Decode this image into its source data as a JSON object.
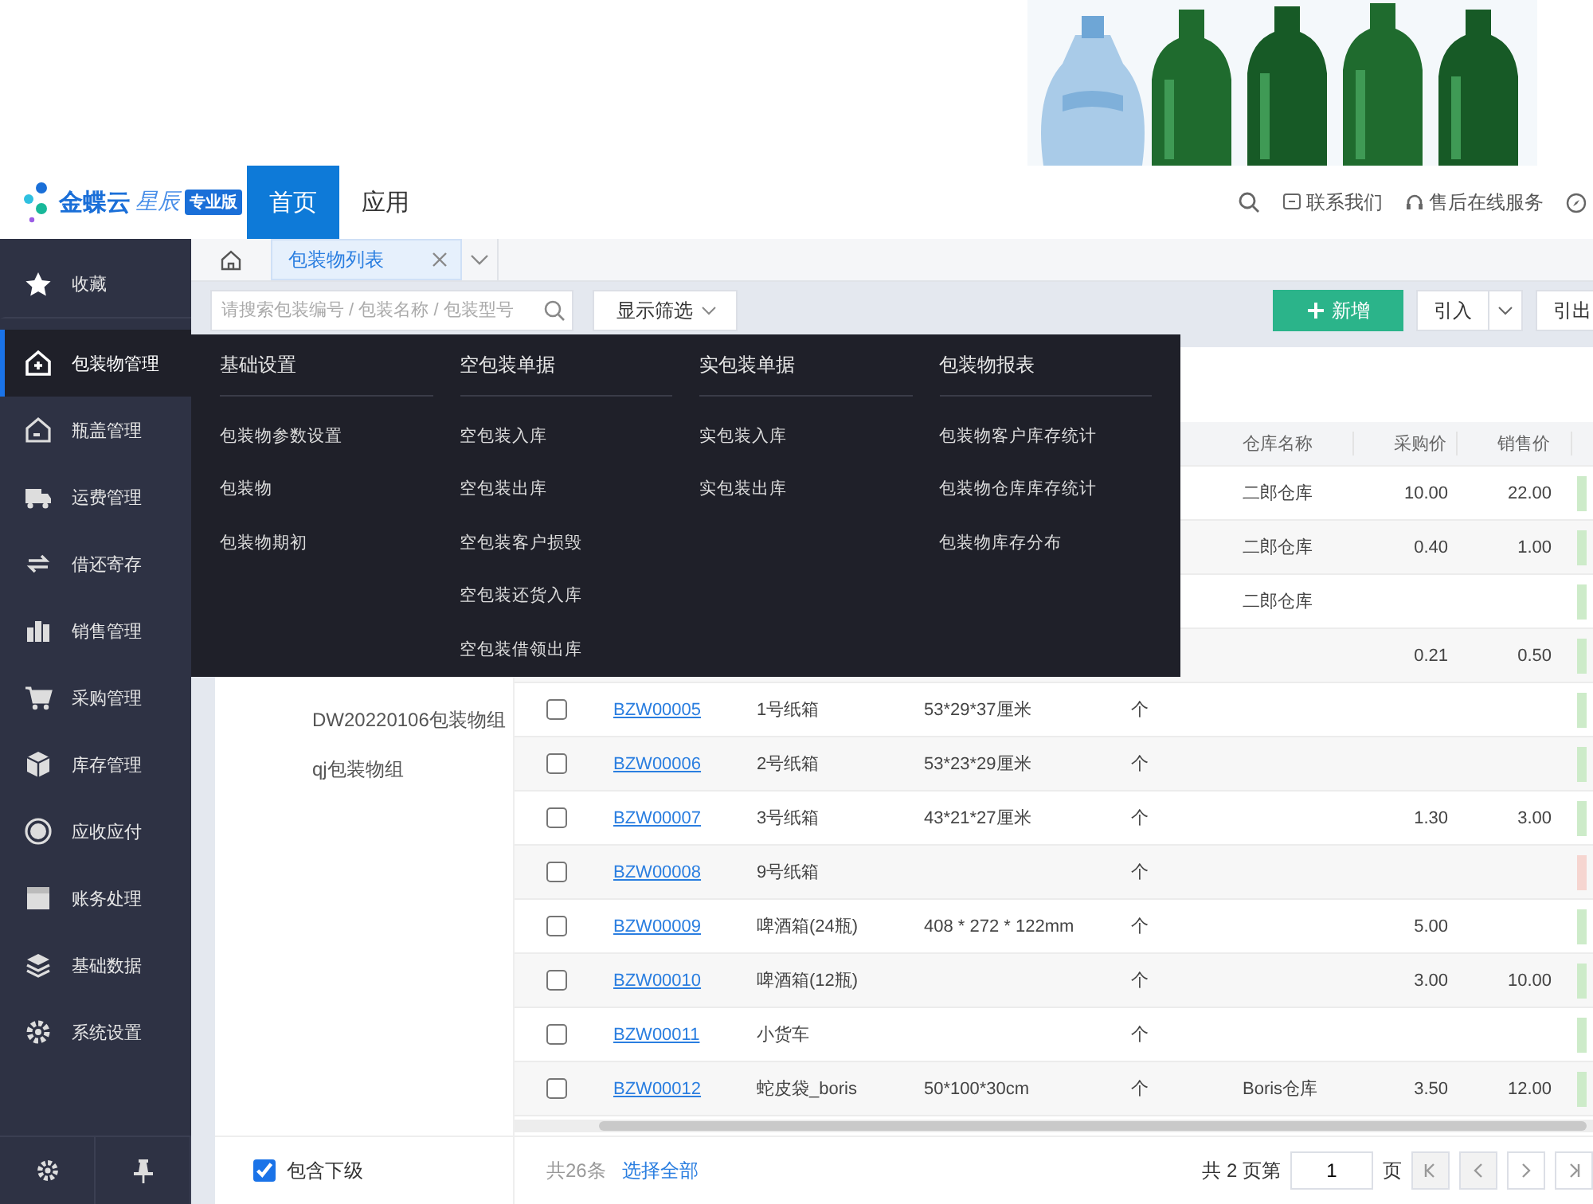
{
  "header": {
    "logo": {
      "name": "金蝶云",
      "sub": "星辰",
      "badge": "专业版"
    },
    "tabs": [
      {
        "label": "首页",
        "selected": true
      },
      {
        "label": "应用",
        "selected": false
      }
    ],
    "links": [
      "联系我们",
      "售后在线服务"
    ]
  },
  "sidebar": {
    "items": [
      {
        "label": "收藏",
        "selected": false
      },
      {
        "label": "包装物管理",
        "selected": true
      },
      {
        "label": "瓶盖管理",
        "selected": false
      },
      {
        "label": "运费管理",
        "selected": false
      },
      {
        "label": "借还寄存",
        "selected": false
      },
      {
        "label": "销售管理",
        "selected": false
      },
      {
        "label": "采购管理",
        "selected": false
      },
      {
        "label": "库存管理",
        "selected": false
      },
      {
        "label": "应收应付",
        "selected": false
      },
      {
        "label": "账务处理",
        "selected": false
      },
      {
        "label": "基础数据",
        "selected": false
      },
      {
        "label": "系统设置",
        "selected": false
      }
    ]
  },
  "tab_bar": {
    "tabs": [
      {
        "label": "包装物列表",
        "selected": true
      }
    ]
  },
  "toolbar": {
    "search": {
      "placeholder": "请搜索包装编号 / 包装名称 / 包装型号"
    },
    "filter_button": "显示筛选",
    "buttons": [
      {
        "label": "新增",
        "kind": "primary"
      },
      {
        "label": "引入",
        "kind": "split"
      },
      {
        "label": "引出",
        "kind": "plain"
      }
    ]
  },
  "menu": {
    "columns": [
      {
        "title": "基础设置",
        "items": [
          "包装物参数设置",
          "包装物",
          "包装物期初"
        ]
      },
      {
        "title": "空包装单据",
        "items": [
          "空包装入库",
          "空包装出库",
          "空包装客户损毁",
          "空包装还货入库",
          "空包装借领出库"
        ]
      },
      {
        "title": "实包装单据",
        "items": [
          "实包装入库",
          "实包装出库"
        ]
      },
      {
        "title": "包装物报表",
        "items": [
          "包装物客户库存统计",
          "包装物仓库库存统计",
          "包装物库存分布"
        ]
      }
    ]
  },
  "tree": {
    "items": [
      "DW20220106包装物组",
      "qj包装物组"
    ]
  },
  "table": {
    "columns": [
      "仓库名称",
      "采购价",
      "销售价"
    ],
    "rows": [
      {
        "warehouse": "二郎仓库",
        "purchase_price": "10.00",
        "sale_price": "22.00",
        "color": "#cdebc9"
      },
      {
        "warehouse": "二郎仓库",
        "purchase_price": "0.40",
        "sale_price": "1.00",
        "color": "#cdebc9"
      },
      {
        "warehouse": "二郎仓库",
        "color": "#cdebc9"
      },
      {
        "purchase_price": "0.21",
        "sale_price": "0.50",
        "color": "#cdebc9"
      },
      {
        "checked": false,
        "code": "BZW00005",
        "name": "1号纸箱",
        "spec": "53*29*37厘米",
        "unit": "个",
        "color": "#cdebc9"
      },
      {
        "checked": false,
        "code": "BZW00006",
        "name": "2号纸箱",
        "spec": "53*23*29厘米",
        "unit": "个",
        "color": "#cdebc9"
      },
      {
        "checked": false,
        "code": "BZW00007",
        "name": "3号纸箱",
        "spec": "43*21*27厘米",
        "unit": "个",
        "purchase_price": "1.30",
        "sale_price": "3.00",
        "color": "#cdebc9"
      },
      {
        "checked": false,
        "code": "BZW00008",
        "name": "9号纸箱",
        "unit": "个",
        "color": "#f6d5d0"
      },
      {
        "checked": false,
        "code": "BZW00009",
        "name": "啤酒箱(24瓶)",
        "spec": "408 * 272 * 122mm",
        "unit": "个",
        "purchase_price": "5.00",
        "color": "#cdebc9"
      },
      {
        "checked": false,
        "code": "BZW00010",
        "name": "啤酒箱(12瓶)",
        "unit": "个",
        "purchase_price": "3.00",
        "sale_price": "10.00",
        "color": "#cdebc9"
      },
      {
        "checked": false,
        "code": "BZW00011",
        "name": "小货车",
        "unit": "个",
        "color": "#cdebc9"
      },
      {
        "checked": false,
        "code": "BZW00012",
        "name": "蛇皮袋_boris",
        "spec": "50*100*30cm",
        "unit": "个",
        "warehouse": "Boris仓库",
        "purchase_price": "3.50",
        "sale_price": "12.00",
        "color": "#cdebc9"
      }
    ]
  },
  "footer": {
    "include_children": {
      "label": "包含下级",
      "checked": true
    },
    "total": "共26条",
    "select_all": "选择全部",
    "pager": {
      "prefix": "共 2 页第",
      "page": "1",
      "suffix": "页",
      "buttons": [
        {
          "kind": "first",
          "disabled": true
        },
        {
          "kind": "prev",
          "disabled": true
        },
        {
          "kind": "next",
          "disabled": false
        },
        {
          "kind": "last",
          "disabled": false
        }
      ]
    }
  }
}
